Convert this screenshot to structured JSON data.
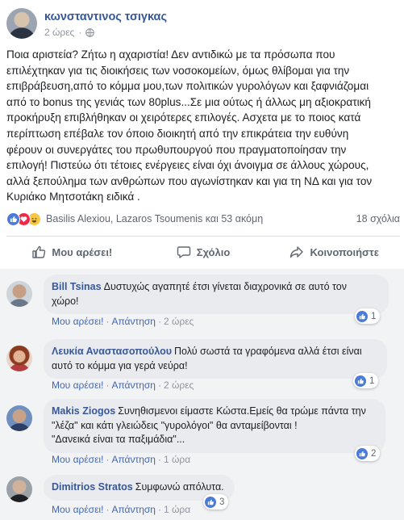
{
  "post": {
    "author": "κωνσταντινος τσιγκας",
    "time": "2 ώρες",
    "text": "Ποια αριστεία? Ζήτω η αχαριστία! Δεν αντιδικώ με τα πρόσωπα που\nεπιλέχτηκαν για τις διοικήσεις των νοσοκομείων, όμως θλίβομαι για την\nεπιβράβευση,από το κόμμα μου,των πολιτικών γυρολόγων και ξαφνιάζομαι\nαπό το bonus της γενιάς των 80plus...Σε μια ούτως ή άλλως μη αξιοκρατική\nπροκήρυξη επιβλήθηκαν οι χειρότερες επιλογές. Ασχετα με το ποιος κατά\nπερίπτωση επέβαλε τον όποιο διοικητή από την επικράτεια την ευθύνη\nφέρουν οι συνεργάτες του πρωθυπουργού που πραγματοποίησαν την\nεπιλογή! Πιστεύω ότι τέτοιες ενέργειες είναι όχι άνοιγμα σε άλλους χώρους,\nαλλά ξεπούλημα των ανθρώπων που αγωνίστηκαν και για τη ΝΔ και για τον\nΚυριάκο Μητσοτάκη ειδικά .",
    "reactions_text": "Basilis Alexiou, Lazaros Tsoumenis και 53 ακόμη",
    "comments_count": "18 σχόλια"
  },
  "actions": {
    "like": "Μου αρέσει!",
    "comment": "Σχόλιο",
    "share": "Κοινοποιήστε"
  },
  "comments": [
    {
      "author": "Bill Tsinas",
      "text": "Δυστυχώς αγαπητέ έτσι γίνεται διαχρονικά σε αυτό τον\nχώρο!",
      "like_label": "Μου αρέσει!",
      "reply_label": "Απάντηση",
      "time": "2 ώρες",
      "likes": "1"
    },
    {
      "author": "Λευκία Αναστασοπούλου",
      "text": "Πολύ σωστά τα γραφόμενα αλλά έτσι είναι\nαυτό το κόμμα για γερά νεύρα!",
      "like_label": "Μου αρέσει!",
      "reply_label": "Απάντηση",
      "time": "2 ώρες",
      "likes": "1"
    },
    {
      "author": "Makis Ziogos",
      "text": "Συνηθισμενοι είμαστε Κώστα.Εμείς θα τρώμε πάντα την\n\"λέζα\" και κάτι γλειώδεις \"γυρολόγοι\" θα ανταμείβονται !\n\"Δανεικά είναι τα παξιμάδια\"...",
      "like_label": "Μου αρέσει!",
      "reply_label": "Απάντηση",
      "time": "1 ώρα",
      "likes": "2"
    },
    {
      "author": "Dimitrios Stratos",
      "text": "Συμφωνώ απόλυτα.",
      "like_label": "Μου αρέσει!",
      "reply_label": "Απάντηση",
      "time": "1 ώρα",
      "likes": "3"
    }
  ]
}
